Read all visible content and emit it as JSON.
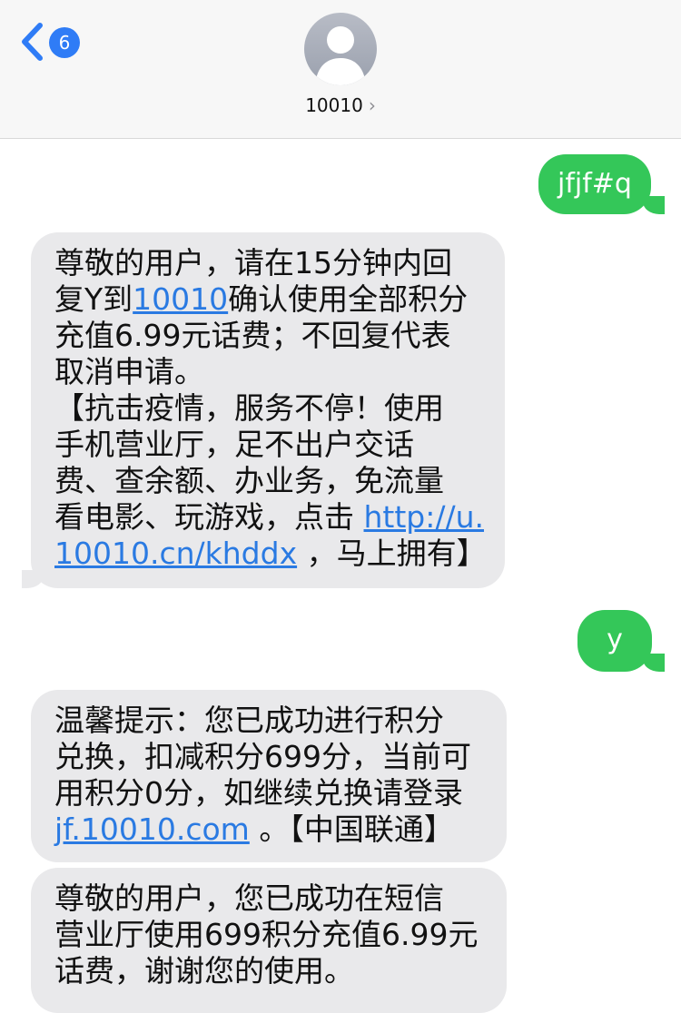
{
  "header": {
    "back_badge_count": "6",
    "contact_name": "10010",
    "contact_chevron": "›"
  },
  "messages": [
    {
      "type": "sent",
      "text": "jfjf#q"
    },
    {
      "type": "received",
      "line1": "尊敬的用户，请在15分钟内回",
      "line2_pre": "复Y到",
      "line2_link": "10010",
      "line2_post": "确认使用全部积分",
      "line3": "充值6.99元话费；不回复代表",
      "line4": "取消申请。",
      "line5": "【抗击疫情，服务不停！使用",
      "line6": "手机营业厅，足不出户交话",
      "line7": "费、查余额、办业务，免流量",
      "line8_pre": "看电影、玩游戏，点击 ",
      "line8_link": "http://u.",
      "line9_link": "10010.cn/khddx",
      "line9_post": " ，马上拥有】"
    },
    {
      "type": "sent",
      "text": "y"
    },
    {
      "type": "received",
      "line1": "温馨提示：您已成功进行积分",
      "line2": "兑换，扣减积分699分，当前可",
      "line3": "用积分0分，如继续兑换请登录",
      "line4_link": "jf.10010.com",
      "line4_post": " 。【中国联通】"
    },
    {
      "type": "received",
      "line1": "尊敬的用户，您已成功在短信",
      "line2": "营业厅使用699积分充值6.99元",
      "line3": "话费，谢谢您的使用。"
    }
  ],
  "colors": {
    "sent_bubble": "#34c759",
    "received_bubble": "#e9e9eb",
    "link": "#2a7ae2",
    "badge": "#2f7cf6"
  }
}
